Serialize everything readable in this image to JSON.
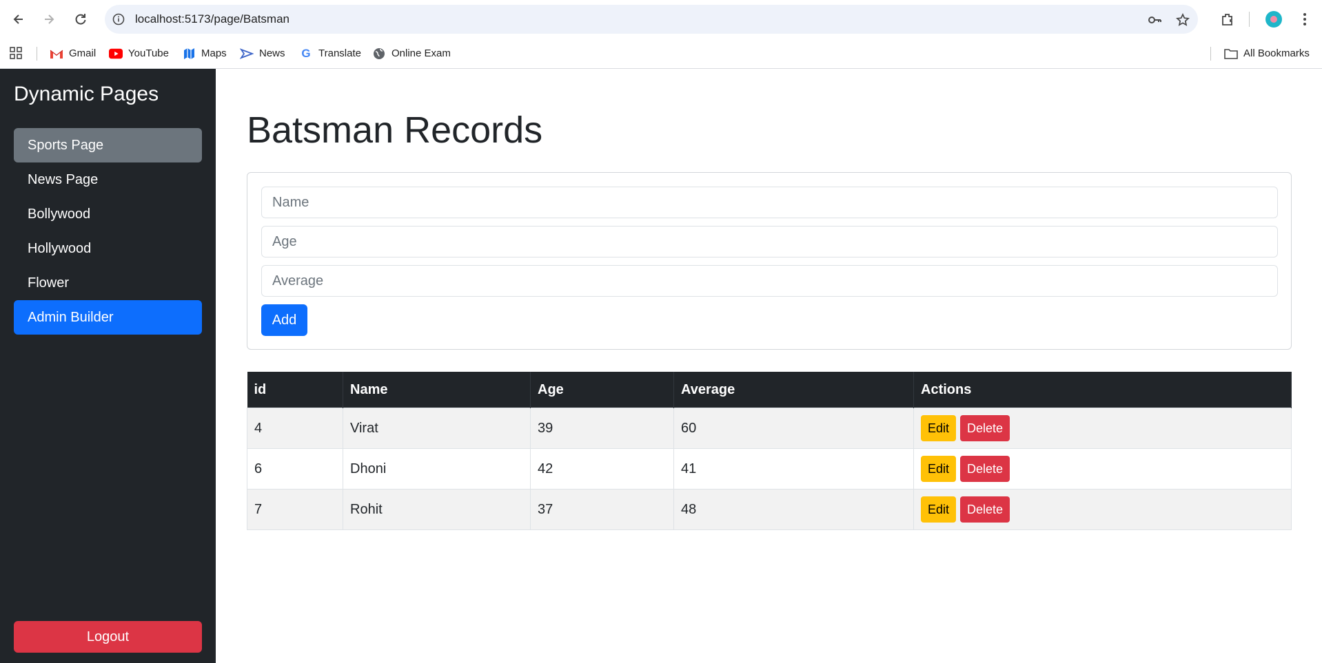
{
  "browser": {
    "url": "localhost:5173/page/Batsman",
    "bookmarks": [
      {
        "label": "Gmail",
        "icon": "gmail-icon"
      },
      {
        "label": "YouTube",
        "icon": "youtube-icon"
      },
      {
        "label": "Maps",
        "icon": "maps-icon"
      },
      {
        "label": "News",
        "icon": "news-icon"
      },
      {
        "label": "Translate",
        "icon": "google-icon"
      },
      {
        "label": "Online Exam",
        "icon": "globe-icon"
      }
    ],
    "all_bookmarks": "All Bookmarks"
  },
  "sidebar": {
    "brand": "Dynamic Pages",
    "items": [
      {
        "label": "Sports Page"
      },
      {
        "label": "News Page"
      },
      {
        "label": "Bollywood"
      },
      {
        "label": "Hollywood"
      },
      {
        "label": "Flower"
      },
      {
        "label": "Admin Builder"
      }
    ],
    "logout": "Logout"
  },
  "main": {
    "title": "Batsman Records",
    "form": {
      "name_placeholder": "Name",
      "age_placeholder": "Age",
      "average_placeholder": "Average",
      "add_label": "Add"
    },
    "table": {
      "headers": [
        "id",
        "Name",
        "Age",
        "Average",
        "Actions"
      ],
      "rows": [
        {
          "id": "4",
          "name": "Virat",
          "age": "39",
          "average": "60"
        },
        {
          "id": "6",
          "name": "Dhoni",
          "age": "42",
          "average": "41"
        },
        {
          "id": "7",
          "name": "Rohit",
          "age": "37",
          "average": "48"
        }
      ],
      "edit_label": "Edit",
      "delete_label": "Delete"
    }
  },
  "colors": {
    "sidebar_bg": "#212529",
    "primary": "#0d6efd",
    "secondary": "#6c757d",
    "danger": "#dc3545",
    "warning": "#ffc107"
  }
}
